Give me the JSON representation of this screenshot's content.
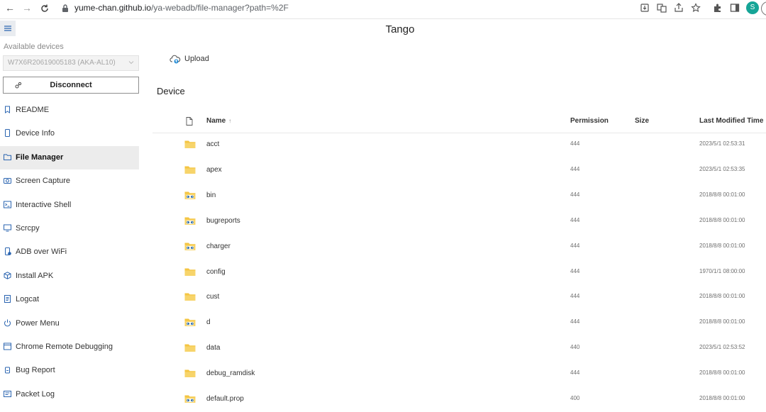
{
  "browser": {
    "url_host": "yume-chan.github.io",
    "url_path": "/ya-webadb/file-manager?path=%2F",
    "profile_initial": "S"
  },
  "app": {
    "title": "Tango"
  },
  "sidebar": {
    "available_devices_label": "Available devices",
    "selected_device": "W7X6R20619005183 (AKA-AL10)",
    "disconnect_label": "Disconnect",
    "items": [
      {
        "label": "README",
        "icon": "bookmark-icon",
        "selected": false
      },
      {
        "label": "Device Info",
        "icon": "phone-icon",
        "selected": false
      },
      {
        "label": "File Manager",
        "icon": "folder-icon",
        "selected": true
      },
      {
        "label": "Screen Capture",
        "icon": "camera-icon",
        "selected": false
      },
      {
        "label": "Interactive Shell",
        "icon": "terminal-icon",
        "selected": false
      },
      {
        "label": "Scrcpy",
        "icon": "mirror-icon",
        "selected": false
      },
      {
        "label": "ADB over WiFi",
        "icon": "wifi-icon",
        "selected": false
      },
      {
        "label": "Install APK",
        "icon": "package-icon",
        "selected": false
      },
      {
        "label": "Logcat",
        "icon": "log-icon",
        "selected": false
      },
      {
        "label": "Power Menu",
        "icon": "power-icon",
        "selected": false
      },
      {
        "label": "Chrome Remote Debugging",
        "icon": "chrome-icon",
        "selected": false
      },
      {
        "label": "Bug Report",
        "icon": "bug-icon",
        "selected": false
      },
      {
        "label": "Packet Log",
        "icon": "packet-icon",
        "selected": false
      }
    ]
  },
  "main": {
    "upload_label": "Upload",
    "section_title": "Device",
    "columns": {
      "name": "Name",
      "sort_indicator": "↑",
      "permission": "Permission",
      "size": "Size",
      "modified": "Last Modified Time"
    },
    "rows": [
      {
        "name": "acct",
        "type": "folder",
        "permission": "444",
        "modified": "2023/5/1 02:53:31"
      },
      {
        "name": "apex",
        "type": "folder",
        "permission": "444",
        "modified": "2023/5/1 02:53:35"
      },
      {
        "name": "bin",
        "type": "link",
        "permission": "444",
        "modified": "2018/8/8 00:01:00"
      },
      {
        "name": "bugreports",
        "type": "link",
        "permission": "444",
        "modified": "2018/8/8 00:01:00"
      },
      {
        "name": "charger",
        "type": "link",
        "permission": "444",
        "modified": "2018/8/8 00:01:00"
      },
      {
        "name": "config",
        "type": "folder",
        "permission": "444",
        "modified": "1970/1/1 08:00:00"
      },
      {
        "name": "cust",
        "type": "folder",
        "permission": "444",
        "modified": "2018/8/8 00:01:00"
      },
      {
        "name": "d",
        "type": "link",
        "permission": "444",
        "modified": "2018/8/8 00:01:00"
      },
      {
        "name": "data",
        "type": "folder",
        "permission": "440",
        "modified": "2023/5/1 02:53:52"
      },
      {
        "name": "debug_ramdisk",
        "type": "folder",
        "permission": "444",
        "modified": "2018/8/8 00:01:00"
      },
      {
        "name": "default.prop",
        "type": "link",
        "permission": "400",
        "modified": "2018/8/8 00:01:00"
      }
    ]
  },
  "colors": {
    "folder": "#f4c542",
    "link_badge": "#2b6cb0",
    "selected_nav_bg": "#ececec",
    "avatar": "#16a597"
  }
}
